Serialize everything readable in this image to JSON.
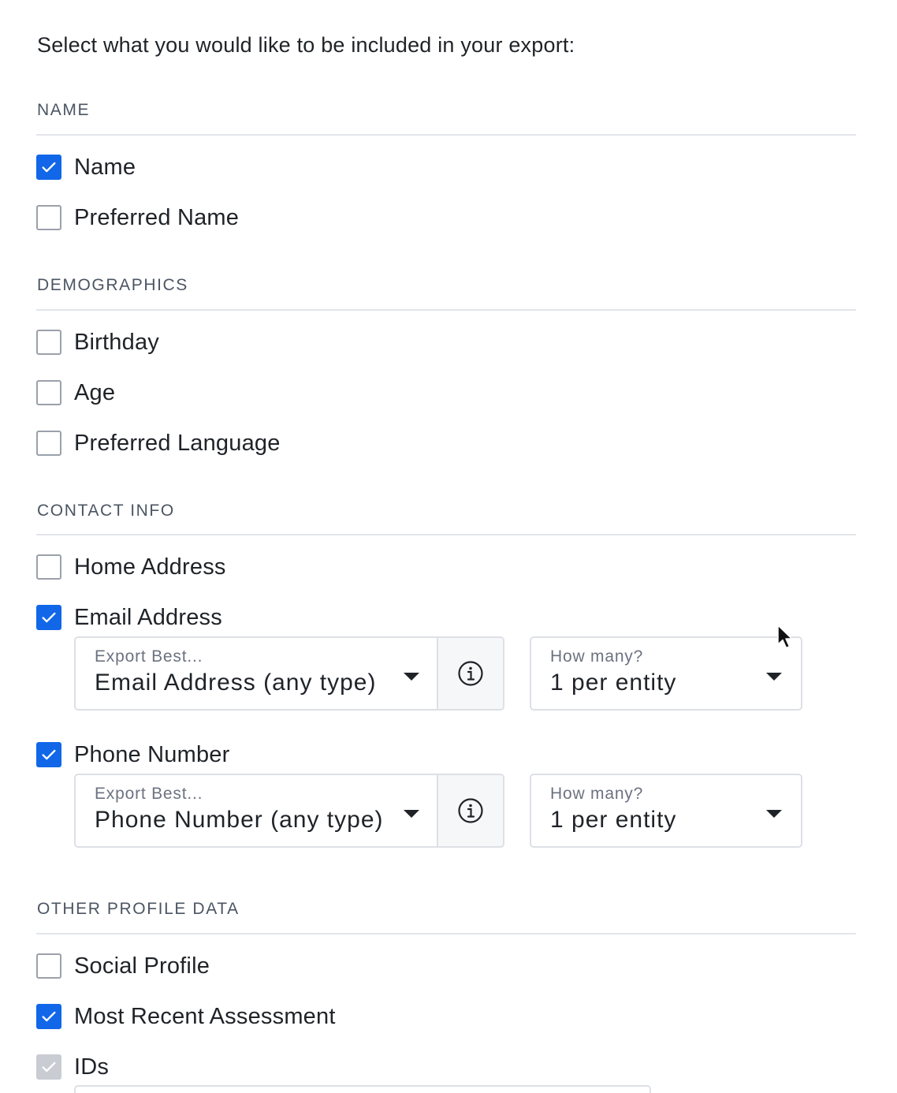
{
  "intro_text": "Select what you would like to be included in your export:",
  "sections": {
    "name": {
      "title": "NAME",
      "options": [
        {
          "label": "Name",
          "checked": true
        },
        {
          "label": "Preferred Name",
          "checked": false
        }
      ]
    },
    "demographics": {
      "title": "DEMOGRAPHICS",
      "options": [
        {
          "label": "Birthday",
          "checked": false
        },
        {
          "label": "Age",
          "checked": false
        },
        {
          "label": "Preferred Language",
          "checked": false
        }
      ]
    },
    "contact": {
      "title": "CONTACT INFO",
      "options": [
        {
          "label": "Home Address",
          "checked": false
        },
        {
          "label": "Email Address",
          "checked": true
        },
        {
          "label": "Phone Number",
          "checked": true
        }
      ],
      "email_export": {
        "caption": "Export Best...",
        "value": "Email Address (any type)"
      },
      "email_count": {
        "caption": "How many?",
        "value": "1 per entity"
      },
      "phone_export": {
        "caption": "Export Best...",
        "value": "Phone Number (any type)"
      },
      "phone_count": {
        "caption": "How many?",
        "value": "1 per entity"
      }
    },
    "other": {
      "title": "OTHER PROFILE DATA",
      "options": [
        {
          "label": "Social Profile",
          "checked": false
        },
        {
          "label": "Most Recent Assessment",
          "checked": true
        },
        {
          "label": "IDs",
          "checked": true,
          "disabled": true
        }
      ]
    }
  },
  "icons": {
    "checkmark": "check-icon",
    "info": "info-icon",
    "dropdown": "caret-down-icon",
    "cursor": "mouse-pointer-icon"
  },
  "colors": {
    "accent": "#1167e8",
    "disabled_check": "#c9ccd2",
    "border": "#dde0e5",
    "info_bg": "#f6f7f9"
  }
}
